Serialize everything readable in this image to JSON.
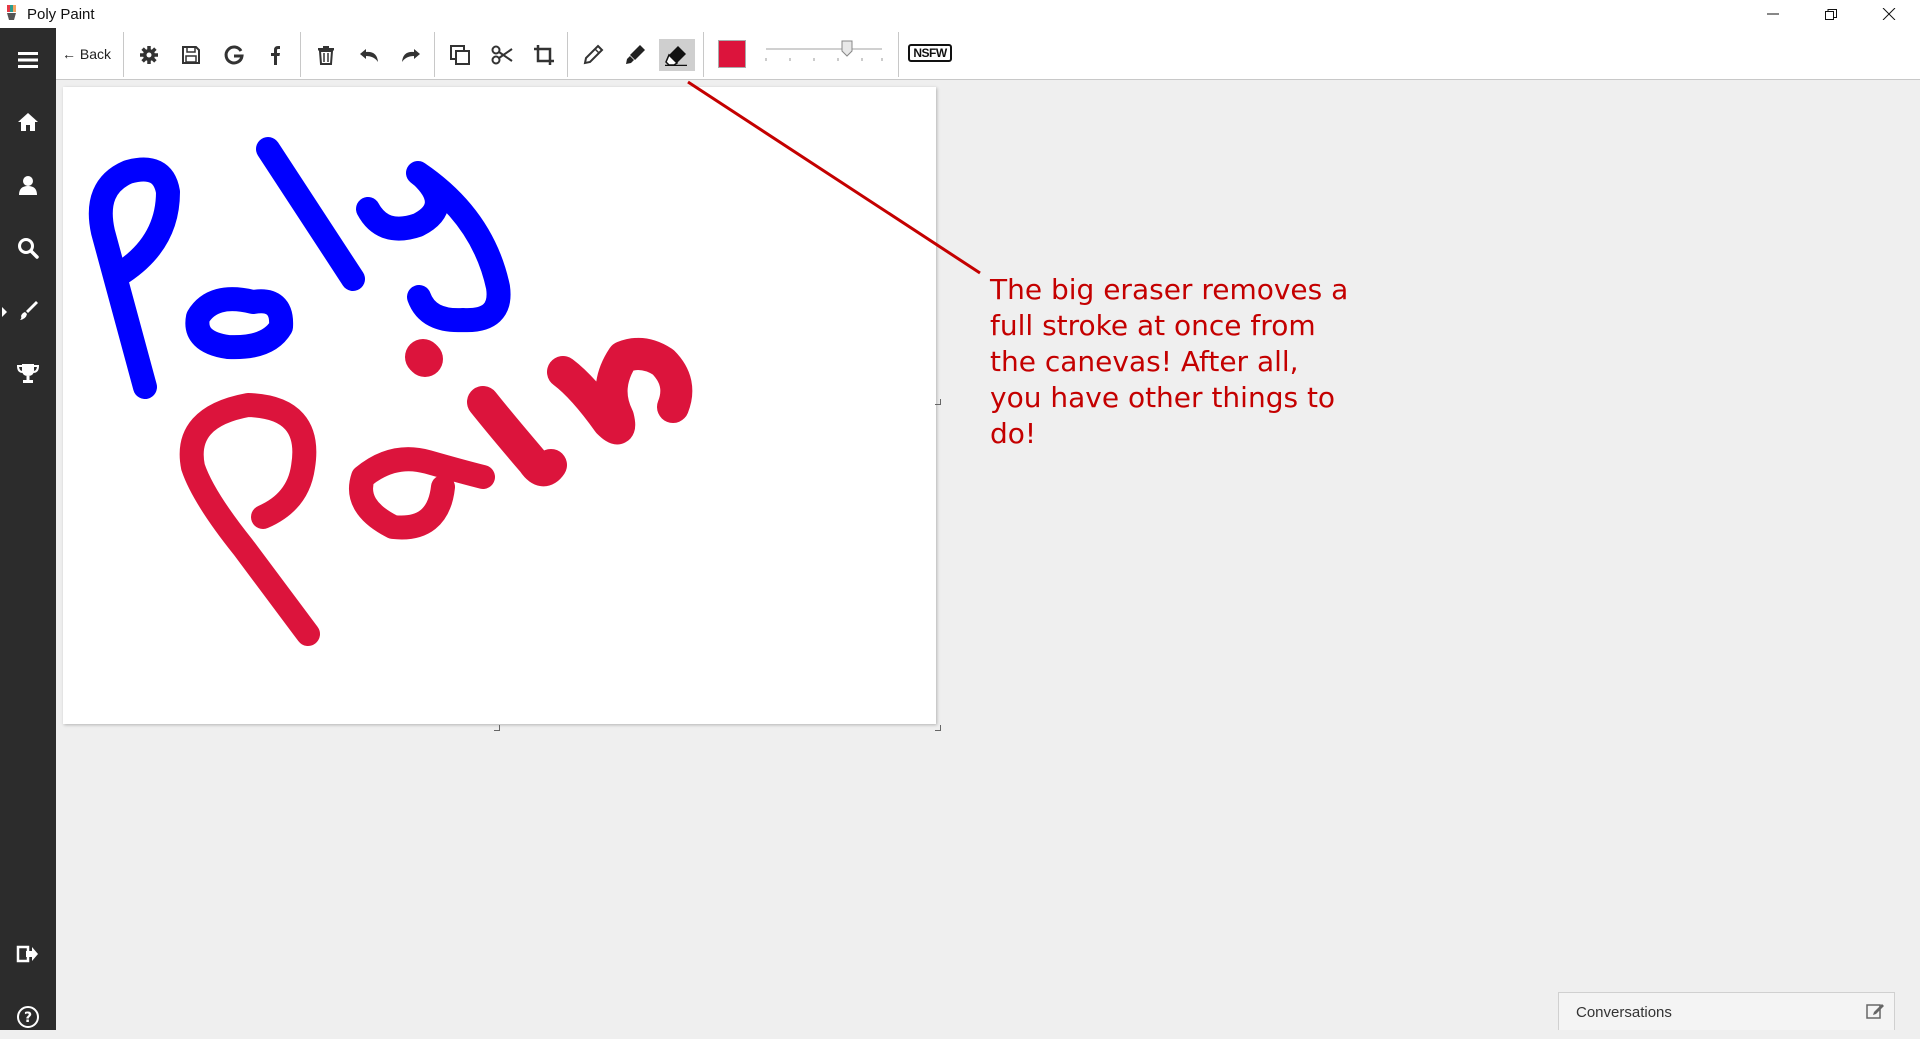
{
  "window": {
    "title": "Poly Paint",
    "controls": [
      "minimize-icon",
      "restore-icon",
      "close-icon"
    ]
  },
  "sidebar": {
    "items": [
      "menu-icon",
      "home-icon",
      "user-icon",
      "search-icon",
      "brush-icon",
      "trophy-icon"
    ],
    "bottom_items": [
      "logout-icon",
      "help-icon"
    ]
  },
  "toolbar": {
    "back_label": "← Back",
    "buttons": [
      "gear-icon",
      "save-icon",
      "google-icon",
      "facebook-icon",
      "trash-icon",
      "undo-icon",
      "redo-icon",
      "duplicate-icon",
      "cut-icon",
      "crop-icon",
      "pencil-icon",
      "marker-icon",
      "eraser-icon"
    ],
    "selected_tool": "eraser-icon",
    "color": "#dc143c",
    "nsfw_label": "NSFW"
  },
  "canvas": {
    "drawing_text": [
      "Poly",
      "Paint"
    ],
    "stroke_colors": [
      "#0000ff",
      "#dc143c"
    ]
  },
  "annotation": {
    "text": "The big eraser removes a\nfull stroke at once from\nthe canevas! After all,\nyou have other things to\ndo!",
    "color": "#c40000"
  },
  "conversations": {
    "label": "Conversations"
  }
}
